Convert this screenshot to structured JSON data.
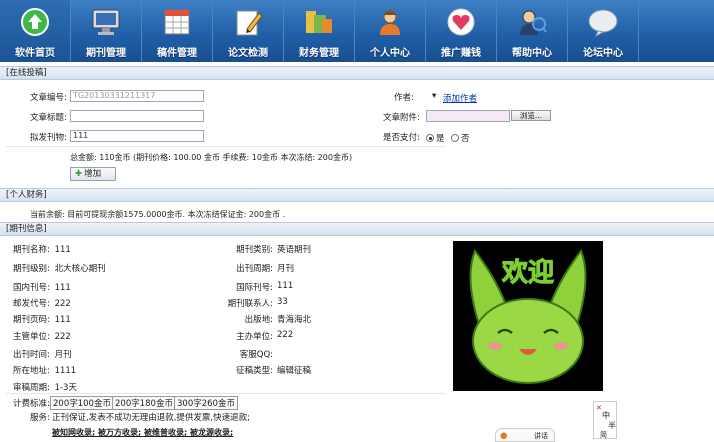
{
  "nav": [
    {
      "label": "软件首页",
      "icon": "arrow-up-circle-icon"
    },
    {
      "label": "期刊管理",
      "icon": "computer-icon"
    },
    {
      "label": "稿件管理",
      "icon": "calendar-icon"
    },
    {
      "label": "论文检测",
      "icon": "pencil-icon"
    },
    {
      "label": "财务管理",
      "icon": "money-icon"
    },
    {
      "label": "个人中心",
      "icon": "user-icon"
    },
    {
      "label": "推广赚钱",
      "icon": "heart-icon"
    },
    {
      "label": "帮助中心",
      "icon": "help-user-icon"
    },
    {
      "label": "论坛中心",
      "icon": "chat-bubble-icon"
    }
  ],
  "submit": {
    "section_title": "[在线投稿]",
    "article_no_label": "文章编号:",
    "article_no_value": "TG20130331211317",
    "author_label": "作者:",
    "add_author": "添加作者",
    "title_label": "文章标题:",
    "title_value": "",
    "attachment_label": "文章附件:",
    "browse_label": "浏览...",
    "journal_label": "拟发刊物:",
    "journal_value": "111",
    "paid_label": "是否支付:",
    "yes_label": "是",
    "no_label": "否",
    "total_text": "总金额: 110金币  (期刊价格: 100.00 金币  手续费: 10金币  本次冻结: 200金币)",
    "add_button": "增加"
  },
  "finance": {
    "section_title": "[个人财务]",
    "balance_text": "当前余额: 目前可提现余额1575.0000金币. 本次冻结保证金: 200金币 ."
  },
  "journal": {
    "section_title": "[期刊信息]",
    "rows_left": [
      {
        "label": "期刊名称:",
        "value": "111"
      },
      {
        "label": "期刊级别:",
        "value": "北大核心期刊"
      },
      {
        "label": "国内刊号:",
        "value": "111"
      },
      {
        "label": "邮发代号:",
        "value": "222"
      },
      {
        "label": "期刊页码:",
        "value": "111"
      },
      {
        "label": "主管单位:",
        "value": "222"
      },
      {
        "label": "出刊时间:",
        "value": "月刊"
      },
      {
        "label": "所在地址:",
        "value": "1111"
      },
      {
        "label": "审稿周期:",
        "value": "1-3天"
      }
    ],
    "rows_right": [
      {
        "label": "期刊类别:",
        "value": "英语期刊"
      },
      {
        "label": "出刊周期:",
        "value": "月刊"
      },
      {
        "label": "国际刊号:",
        "value": "111"
      },
      {
        "label": "期刊联系人:",
        "value": "33"
      },
      {
        "label": "出版地:",
        "value": "青海海北"
      },
      {
        "label": "主办单位:",
        "value": "222"
      },
      {
        "label": "客服QQ:",
        "value": ""
      },
      {
        "label": "征稿类型:",
        "value": "编辑征稿"
      }
    ],
    "fee_label": "计费标准:",
    "fee_items": [
      "200字100金币",
      "200字180金币",
      "300字260金币"
    ],
    "service_label": "服务:",
    "service_text": "正刊保证,发表不成功无理由退款,提供发票,快速退款;",
    "index_text": "被知网收录;  被万方收录;  被维普收录;  被龙源收录;",
    "image_text": "欢迎"
  },
  "float_ad": {
    "text1": "中",
    "text2": "半",
    "text3": "简",
    "tab": "讲话"
  }
}
